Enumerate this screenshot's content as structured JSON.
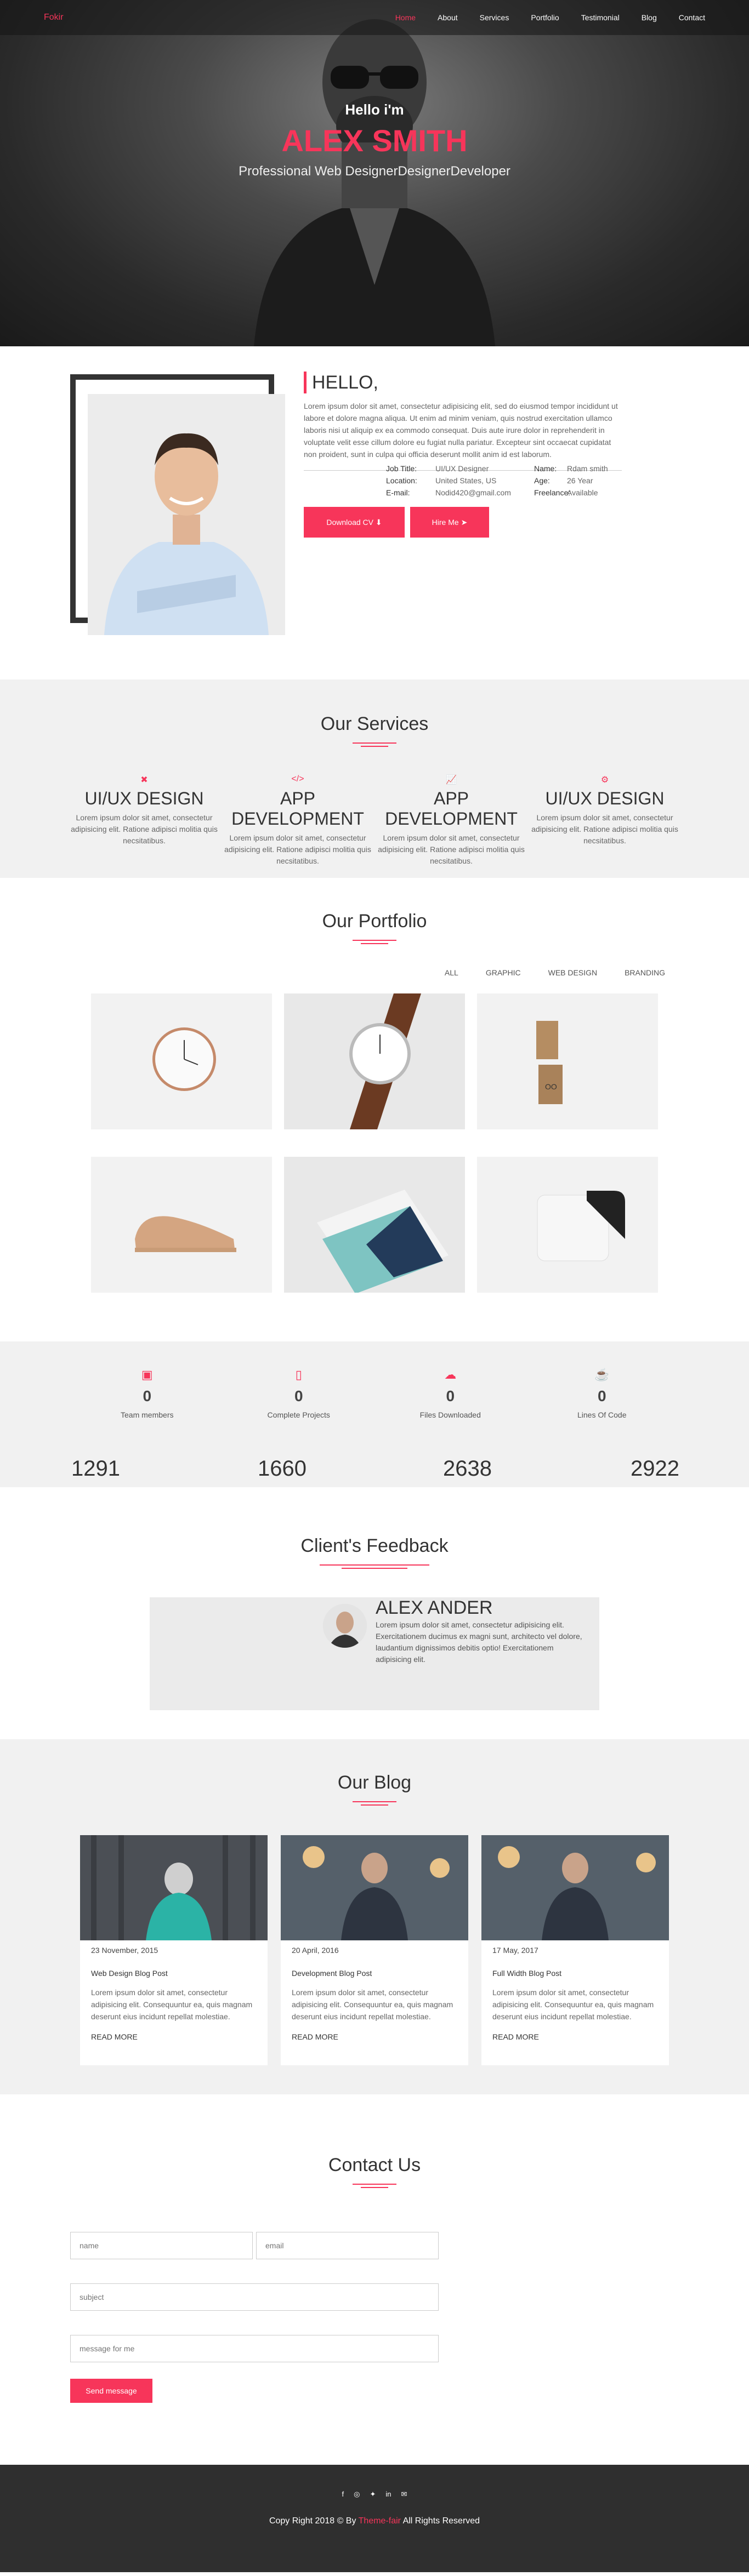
{
  "nav": {
    "brand": "Fokir",
    "items": [
      {
        "label": "Home",
        "active": true
      },
      {
        "label": "About"
      },
      {
        "label": "Services"
      },
      {
        "label": "Portfolio"
      },
      {
        "label": "Testimonial"
      },
      {
        "label": "Blog"
      },
      {
        "label": "Contact"
      }
    ]
  },
  "hero": {
    "hello": "Hello i'm",
    "name": "ALEX SMITH",
    "subtitle": "Professional Web DesignerDesignerDeveloper"
  },
  "about": {
    "heading": "HELLO,",
    "paragraph": "Lorem ipsum dolor sit amet, consectetur adipisicing elit, sed do eiusmod tempor incididunt ut labore et dolore magna aliqua. Ut enim ad minim veniam, quis nostrud exercitation ullamco laboris nisi ut aliquip ex ea commodo consequat. Duis aute irure dolor in reprehenderit in voluptate velit esse cillum dolore eu fugiat nulla pariatur. Excepteur sint occaecat cupidatat non proident, sunt in culpa qui officia deserunt mollit anim id est laborum.",
    "info": {
      "job_label": "Job Title:",
      "job_value": "UI/UX Designer",
      "name_label": "Name:",
      "name_value": "Rdam smith",
      "loc_label": "Location:",
      "loc_value": "United States, US",
      "age_label": "Age:",
      "age_value": "26 Year",
      "email_label": "E-mail:",
      "email_value": "Nodid420@gmail.com",
      "free_label": "Freelance:",
      "free_value": "Available"
    },
    "download_label": "Download CV",
    "hire_label": "Hire Me"
  },
  "services": {
    "title": "Our Services",
    "items": [
      {
        "icon": "cross-icon",
        "title": "UI/UX DESIGN",
        "text": "Lorem ipsum dolor sit amet, consectetur adipisicing elit. Ratione adipisci molitia quis necsitatibus."
      },
      {
        "icon": "code-icon",
        "title": "APP DEVELOPMENT",
        "text": "Lorem ipsum dolor sit amet, consectetur adipisicing elit. Ratione adipisci molitia quis necsitatibus."
      },
      {
        "icon": "chart-icon",
        "title": "APP DEVELOPMENT",
        "text": "Lorem ipsum dolor sit amet, consectetur adipisicing elit. Ratione adipisci molitia quis necsitatibus."
      },
      {
        "icon": "gears-icon",
        "title": "UI/UX DESIGN",
        "text": "Lorem ipsum dolor sit amet, consectetur adipisicing elit. Ratione adipisci molitia quis necsitatibus."
      }
    ]
  },
  "portfolio": {
    "title": "Our Portfolio",
    "filters": [
      "ALL",
      "GRAPHIC",
      "WEB DESIGN",
      "BRANDING"
    ]
  },
  "counters": {
    "items": [
      {
        "icon": "id-card-icon",
        "value": "0",
        "label": "Team members"
      },
      {
        "icon": "file-icon",
        "value": "0",
        "label": "Complete Projects"
      },
      {
        "icon": "cloud-download-icon",
        "value": "0",
        "label": "Files Downloaded"
      },
      {
        "icon": "coffee-icon",
        "value": "0",
        "label": "Lines Of Code"
      }
    ],
    "big": [
      "1291",
      "1660",
      "2638",
      "2922"
    ]
  },
  "feedback": {
    "title": "Client's Feedback",
    "name": "ALEX ANDER",
    "text": "Lorem ipsum dolor sit amet, consectetur adipisicing elit. Exercitationem ducimus ex magni sunt, architecto vel dolore, laudantium dignissimos debitis optio! Exercitationem adipisicing elit."
  },
  "blog": {
    "title": "Our Blog",
    "posts": [
      {
        "date": "23 November, 2015",
        "title": "Web Design Blog Post",
        "text": "Lorem ipsum dolor sit amet, consectetur adipisicing elit. Consequuntur ea, quis magnam deserunt eius incidunt repellat molestiae.",
        "more": "READ MORE"
      },
      {
        "date": "20 April, 2016",
        "title": "Development Blog Post",
        "text": "Lorem ipsum dolor sit amet, consectetur adipisicing elit. Consequuntur ea, quis magnam deserunt eius incidunt repellat molestiae.",
        "more": "READ MORE"
      },
      {
        "date": "17 May, 2017",
        "title": "Full Width Blog Post",
        "text": "Lorem ipsum dolor sit amet, consectetur adipisicing elit. Consequuntur ea, quis magnam deserunt eius incidunt repellat molestiae.",
        "more": "READ MORE"
      }
    ]
  },
  "contact": {
    "title": "Contact Us",
    "name_ph": "name",
    "email_ph": "email",
    "subject_ph": "subject",
    "message_ph": "message for me",
    "send_label": "Send message"
  },
  "footer": {
    "socials": [
      "facebook-icon",
      "instagram-icon",
      "twitter-icon",
      "linkedin-icon",
      "envelope-icon"
    ],
    "copy_pre": "Copy Right 2018 © By ",
    "copy_brand": "Theme-fair",
    "copy_post": " All Rights Reserved"
  },
  "colors": {
    "accent": "#f7355a",
    "dark": "#2f2f2f",
    "light_bg": "#f1f1f1"
  }
}
